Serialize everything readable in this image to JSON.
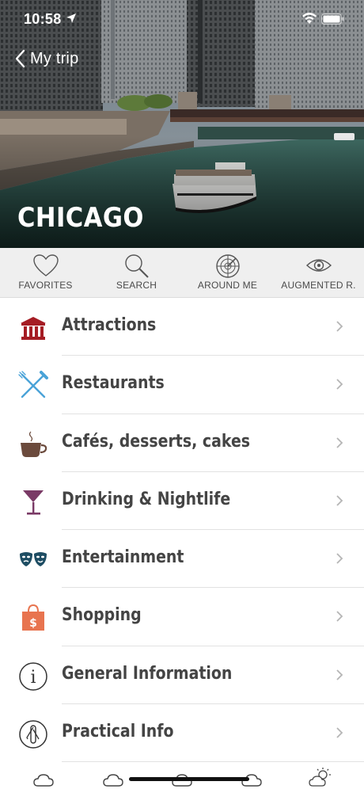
{
  "status_bar": {
    "time": "10:58"
  },
  "header": {
    "back_label": "My trip",
    "city": "CHICAGO"
  },
  "quick_tabs": [
    {
      "label": "FAVORITES",
      "icon": "heart-icon"
    },
    {
      "label": "SEARCH",
      "icon": "search-icon"
    },
    {
      "label": "AROUND ME",
      "icon": "radar-icon"
    },
    {
      "label": "AUGMENTED R.",
      "icon": "eye-icon"
    }
  ],
  "categories": [
    {
      "label": "Attractions",
      "icon": "museum-icon",
      "color": "#a51c24"
    },
    {
      "label": "Restaurants",
      "icon": "fork-knife-icon",
      "color": "#4aa3d8"
    },
    {
      "label": "Cafés, desserts, cakes",
      "icon": "coffee-cup-icon",
      "color": "#6b4a3c"
    },
    {
      "label": "Drinking & Nightlife",
      "icon": "cocktail-glass-icon",
      "color": "#7a3a66"
    },
    {
      "label": "Entertainment",
      "icon": "theater-masks-icon",
      "color": "#1e4d63"
    },
    {
      "label": "Shopping",
      "icon": "shopping-bag-icon",
      "color": "#e8744f"
    },
    {
      "label": "General Information",
      "icon": "info-icon",
      "color": "#333333"
    },
    {
      "label": "Practical Info",
      "icon": "pocket-knife-icon",
      "color": "#333333"
    }
  ],
  "bottom_bar": {
    "icons": [
      "cloud-icon",
      "cloud-icon",
      "cloud-icon",
      "cloud-icon",
      "partly-sunny-icon"
    ]
  }
}
